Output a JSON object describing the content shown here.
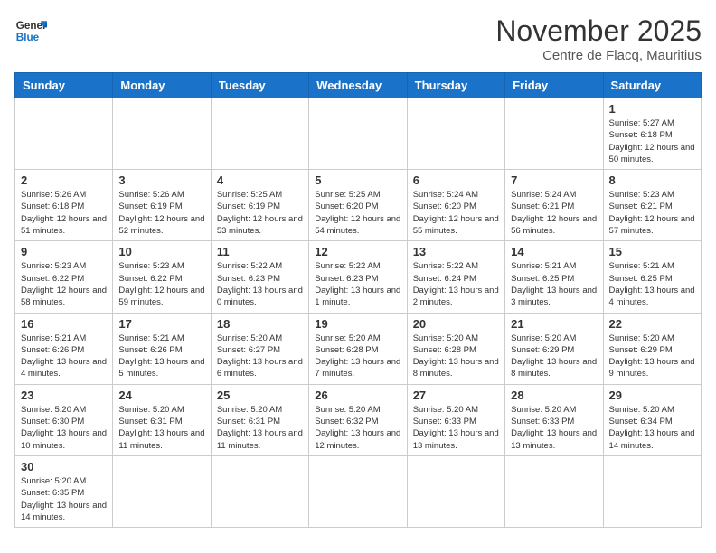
{
  "logo": {
    "line1": "General",
    "line2": "Blue"
  },
  "calendar": {
    "title": "November 2025",
    "subtitle": "Centre de Flacq, Mauritius",
    "days_of_week": [
      "Sunday",
      "Monday",
      "Tuesday",
      "Wednesday",
      "Thursday",
      "Friday",
      "Saturday"
    ],
    "weeks": [
      [
        {
          "num": "",
          "info": ""
        },
        {
          "num": "",
          "info": ""
        },
        {
          "num": "",
          "info": ""
        },
        {
          "num": "",
          "info": ""
        },
        {
          "num": "",
          "info": ""
        },
        {
          "num": "",
          "info": ""
        },
        {
          "num": "1",
          "info": "Sunrise: 5:27 AM\nSunset: 6:18 PM\nDaylight: 12 hours and 50 minutes."
        }
      ],
      [
        {
          "num": "2",
          "info": "Sunrise: 5:26 AM\nSunset: 6:18 PM\nDaylight: 12 hours and 51 minutes."
        },
        {
          "num": "3",
          "info": "Sunrise: 5:26 AM\nSunset: 6:19 PM\nDaylight: 12 hours and 52 minutes."
        },
        {
          "num": "4",
          "info": "Sunrise: 5:25 AM\nSunset: 6:19 PM\nDaylight: 12 hours and 53 minutes."
        },
        {
          "num": "5",
          "info": "Sunrise: 5:25 AM\nSunset: 6:20 PM\nDaylight: 12 hours and 54 minutes."
        },
        {
          "num": "6",
          "info": "Sunrise: 5:24 AM\nSunset: 6:20 PM\nDaylight: 12 hours and 55 minutes."
        },
        {
          "num": "7",
          "info": "Sunrise: 5:24 AM\nSunset: 6:21 PM\nDaylight: 12 hours and 56 minutes."
        },
        {
          "num": "8",
          "info": "Sunrise: 5:23 AM\nSunset: 6:21 PM\nDaylight: 12 hours and 57 minutes."
        }
      ],
      [
        {
          "num": "9",
          "info": "Sunrise: 5:23 AM\nSunset: 6:22 PM\nDaylight: 12 hours and 58 minutes."
        },
        {
          "num": "10",
          "info": "Sunrise: 5:23 AM\nSunset: 6:22 PM\nDaylight: 12 hours and 59 minutes."
        },
        {
          "num": "11",
          "info": "Sunrise: 5:22 AM\nSunset: 6:23 PM\nDaylight: 13 hours and 0 minutes."
        },
        {
          "num": "12",
          "info": "Sunrise: 5:22 AM\nSunset: 6:23 PM\nDaylight: 13 hours and 1 minute."
        },
        {
          "num": "13",
          "info": "Sunrise: 5:22 AM\nSunset: 6:24 PM\nDaylight: 13 hours and 2 minutes."
        },
        {
          "num": "14",
          "info": "Sunrise: 5:21 AM\nSunset: 6:25 PM\nDaylight: 13 hours and 3 minutes."
        },
        {
          "num": "15",
          "info": "Sunrise: 5:21 AM\nSunset: 6:25 PM\nDaylight: 13 hours and 4 minutes."
        }
      ],
      [
        {
          "num": "16",
          "info": "Sunrise: 5:21 AM\nSunset: 6:26 PM\nDaylight: 13 hours and 4 minutes."
        },
        {
          "num": "17",
          "info": "Sunrise: 5:21 AM\nSunset: 6:26 PM\nDaylight: 13 hours and 5 minutes."
        },
        {
          "num": "18",
          "info": "Sunrise: 5:20 AM\nSunset: 6:27 PM\nDaylight: 13 hours and 6 minutes."
        },
        {
          "num": "19",
          "info": "Sunrise: 5:20 AM\nSunset: 6:28 PM\nDaylight: 13 hours and 7 minutes."
        },
        {
          "num": "20",
          "info": "Sunrise: 5:20 AM\nSunset: 6:28 PM\nDaylight: 13 hours and 8 minutes."
        },
        {
          "num": "21",
          "info": "Sunrise: 5:20 AM\nSunset: 6:29 PM\nDaylight: 13 hours and 8 minutes."
        },
        {
          "num": "22",
          "info": "Sunrise: 5:20 AM\nSunset: 6:29 PM\nDaylight: 13 hours and 9 minutes."
        }
      ],
      [
        {
          "num": "23",
          "info": "Sunrise: 5:20 AM\nSunset: 6:30 PM\nDaylight: 13 hours and 10 minutes."
        },
        {
          "num": "24",
          "info": "Sunrise: 5:20 AM\nSunset: 6:31 PM\nDaylight: 13 hours and 11 minutes."
        },
        {
          "num": "25",
          "info": "Sunrise: 5:20 AM\nSunset: 6:31 PM\nDaylight: 13 hours and 11 minutes."
        },
        {
          "num": "26",
          "info": "Sunrise: 5:20 AM\nSunset: 6:32 PM\nDaylight: 13 hours and 12 minutes."
        },
        {
          "num": "27",
          "info": "Sunrise: 5:20 AM\nSunset: 6:33 PM\nDaylight: 13 hours and 13 minutes."
        },
        {
          "num": "28",
          "info": "Sunrise: 5:20 AM\nSunset: 6:33 PM\nDaylight: 13 hours and 13 minutes."
        },
        {
          "num": "29",
          "info": "Sunrise: 5:20 AM\nSunset: 6:34 PM\nDaylight: 13 hours and 14 minutes."
        }
      ],
      [
        {
          "num": "30",
          "info": "Sunrise: 5:20 AM\nSunset: 6:35 PM\nDaylight: 13 hours and 14 minutes."
        },
        {
          "num": "",
          "info": ""
        },
        {
          "num": "",
          "info": ""
        },
        {
          "num": "",
          "info": ""
        },
        {
          "num": "",
          "info": ""
        },
        {
          "num": "",
          "info": ""
        },
        {
          "num": "",
          "info": ""
        }
      ]
    ]
  }
}
